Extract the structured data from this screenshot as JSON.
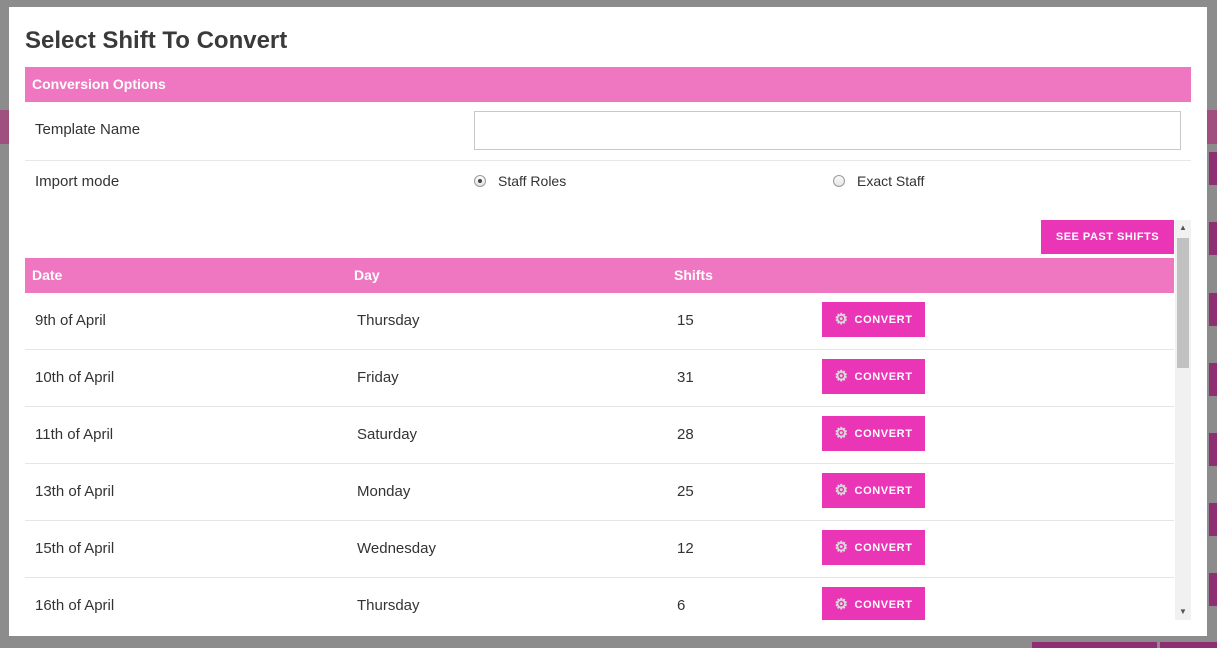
{
  "modal": {
    "title": "Select Shift To Convert"
  },
  "conversion_options": {
    "header": "Conversion Options",
    "template_name_label": "Template Name",
    "template_name_value": "",
    "import_mode_label": "Import mode",
    "import_mode_options": [
      {
        "label": "Staff Roles",
        "selected": true
      },
      {
        "label": "Exact Staff",
        "selected": false
      }
    ]
  },
  "actions": {
    "see_past_shifts": "SEE PAST SHIFTS"
  },
  "table": {
    "columns": [
      "Date",
      "Day",
      "Shifts"
    ],
    "convert_label": "CONVERT",
    "rows": [
      {
        "date": "9th of April",
        "day": "Thursday",
        "shifts": "15"
      },
      {
        "date": "10th of April",
        "day": "Friday",
        "shifts": "31"
      },
      {
        "date": "11th of April",
        "day": "Saturday",
        "shifts": "28"
      },
      {
        "date": "13th of April",
        "day": "Monday",
        "shifts": "25"
      },
      {
        "date": "15th of April",
        "day": "Wednesday",
        "shifts": "12"
      },
      {
        "date": "16th of April",
        "day": "Thursday",
        "shifts": "6"
      }
    ]
  },
  "colors": {
    "header_pink": "#ef77c1",
    "button_magenta": "#ea35b7"
  },
  "icons": {
    "convert": "gear-icon",
    "scroll_up": "arrow-up-icon",
    "scroll_down": "arrow-down-icon"
  }
}
